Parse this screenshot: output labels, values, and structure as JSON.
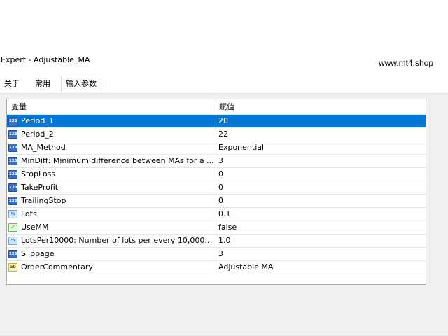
{
  "window": {
    "title": "Expert - Adjustable_MA",
    "watermark": "www.mt4.shop"
  },
  "tabs": [
    {
      "label": "关于",
      "active": false
    },
    {
      "label": "常用",
      "active": false
    },
    {
      "label": "输入参数",
      "active": true
    }
  ],
  "grid": {
    "columns": [
      "变量",
      "赋值"
    ],
    "selected_row": 0,
    "rows": [
      {
        "icon": "int-icon",
        "type_glyph": "123",
        "name": "Period_1",
        "value": "20"
      },
      {
        "icon": "int-icon",
        "type_glyph": "123",
        "name": "Period_2",
        "value": "22"
      },
      {
        "icon": "int-icon",
        "type_glyph": "123",
        "name": "MA_Method",
        "value": "Exponential"
      },
      {
        "icon": "int-icon",
        "type_glyph": "123",
        "name": "MinDiff: Minimum difference between MAs for a ...",
        "value": "3"
      },
      {
        "icon": "int-icon",
        "type_glyph": "123",
        "name": "StopLoss",
        "value": "0"
      },
      {
        "icon": "int-icon",
        "type_glyph": "123",
        "name": "TakeProfit",
        "value": "0"
      },
      {
        "icon": "int-icon",
        "type_glyph": "123",
        "name": "TrailingStop",
        "value": "0"
      },
      {
        "icon": "double-icon",
        "type_glyph": "½",
        "name": "Lots",
        "value": "0.1"
      },
      {
        "icon": "bool-icon",
        "type_glyph": "✓",
        "name": "UseMM",
        "value": "false"
      },
      {
        "icon": "double-icon",
        "type_glyph": "½",
        "name": "LotsPer10000: Number of lots per every 10,000 of...",
        "value": "1.0"
      },
      {
        "icon": "int-icon",
        "type_glyph": "123",
        "name": "Slippage",
        "value": "3"
      },
      {
        "icon": "string-icon",
        "type_glyph": "ab",
        "name": "OrderCommentary",
        "value": "Adjustable MA"
      }
    ]
  },
  "colors": {
    "selection": "#0078d7",
    "panel_background": "#f0f0f0"
  }
}
